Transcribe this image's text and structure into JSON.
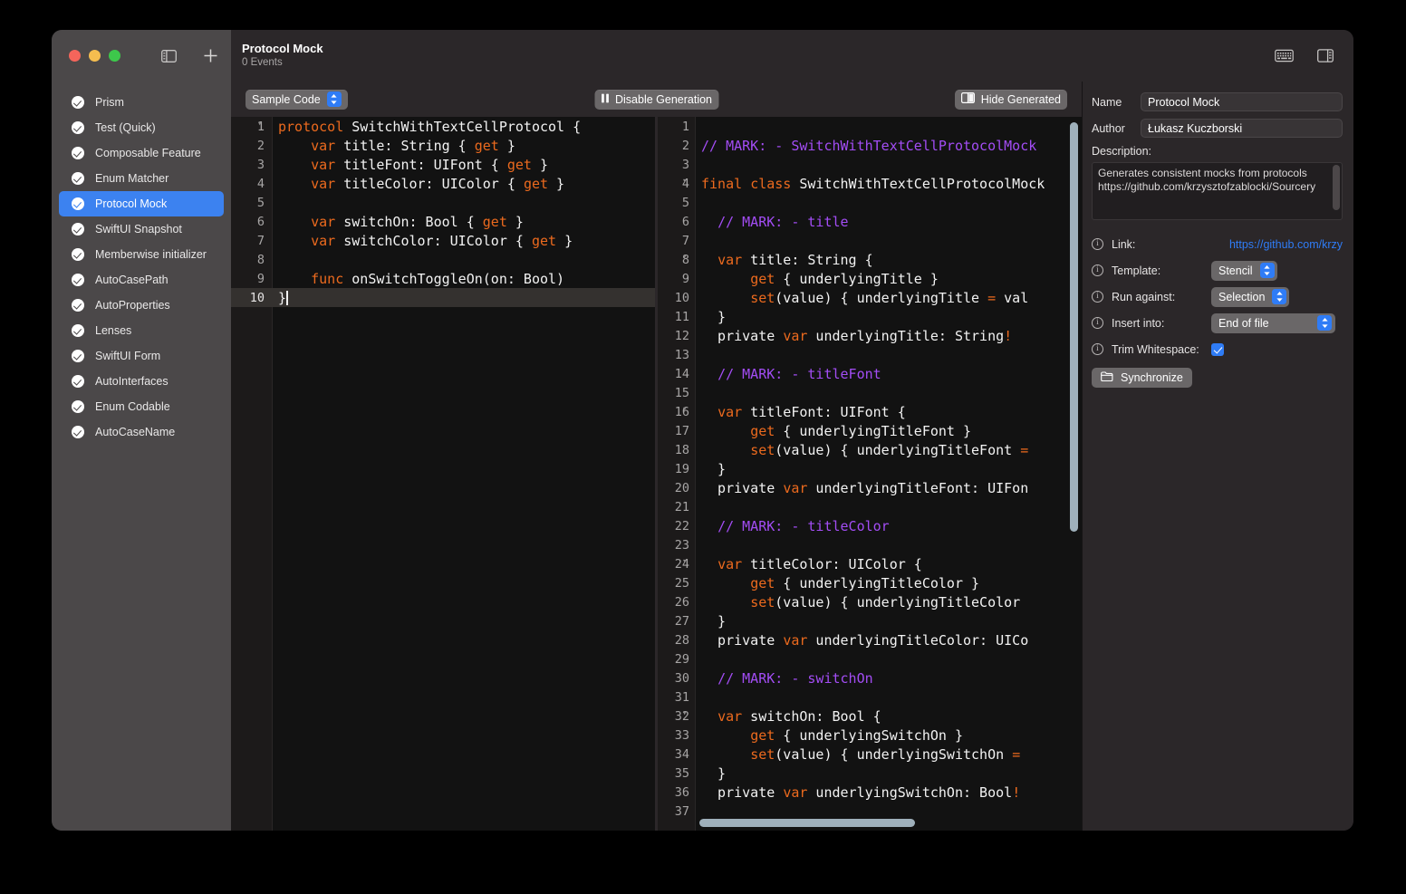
{
  "titlebar": {
    "document_title": "Protocol Mock",
    "document_subtitle": "0 Events",
    "sidebar_toggle_icon": "sidebar-toggle-icon",
    "add_icon": "plus-icon",
    "keyboard_icon": "keyboard-icon",
    "inspector_toggle_icon": "inspector-toggle-icon"
  },
  "sidebar": {
    "items": [
      {
        "label": "Prism",
        "selected": false
      },
      {
        "label": "Test (Quick)",
        "selected": false
      },
      {
        "label": "Composable Feature",
        "selected": false
      },
      {
        "label": "Enum Matcher",
        "selected": false
      },
      {
        "label": "Protocol Mock",
        "selected": true
      },
      {
        "label": "SwiftUI Snapshot",
        "selected": false
      },
      {
        "label": "Memberwise initializer",
        "selected": false
      },
      {
        "label": "AutoCasePath",
        "selected": false
      },
      {
        "label": "AutoProperties",
        "selected": false
      },
      {
        "label": "Lenses",
        "selected": false
      },
      {
        "label": "SwiftUI Form",
        "selected": false
      },
      {
        "label": "AutoInterfaces",
        "selected": false
      },
      {
        "label": "Enum Codable",
        "selected": false
      },
      {
        "label": "AutoCaseName",
        "selected": false
      }
    ]
  },
  "toolbar": {
    "sample_code_label": "Sample Code",
    "disable_generation_label": "Disable Generation",
    "hide_generated_label": "Hide Generated",
    "pause_icon": "pause-icon",
    "panel_icon": "panel-split-icon"
  },
  "source_editor": {
    "lines": [
      {
        "n": "1",
        "fold": true,
        "html": "<span class=\"kw\">protocol</span> SwitchWithTextCellProtocol {"
      },
      {
        "n": "2",
        "fold": false,
        "html": "    <span class=\"kw\">var</span> title: String { <span class=\"kw\">get</span> }"
      },
      {
        "n": "3",
        "fold": false,
        "html": "    <span class=\"kw\">var</span> titleFont: UIFont { <span class=\"kw\">get</span> }"
      },
      {
        "n": "4",
        "fold": false,
        "html": "    <span class=\"kw\">var</span> titleColor: UIColor { <span class=\"kw\">get</span> }"
      },
      {
        "n": "5",
        "fold": false,
        "html": ""
      },
      {
        "n": "6",
        "fold": false,
        "html": "    <span class=\"kw\">var</span> switchOn: Bool { <span class=\"kw\">get</span> }"
      },
      {
        "n": "7",
        "fold": false,
        "html": "    <span class=\"kw\">var</span> switchColor: UIColor { <span class=\"kw\">get</span> }"
      },
      {
        "n": "8",
        "fold": false,
        "html": ""
      },
      {
        "n": "9",
        "fold": false,
        "html": "    <span class=\"kw\">func</span> onSwitchToggleOn(on: Bool)"
      },
      {
        "n": "10",
        "fold": false,
        "current": true,
        "html": "}<span class=\"caret\"></span>"
      }
    ]
  },
  "generated_editor": {
    "lines": [
      {
        "n": "1",
        "html": ""
      },
      {
        "n": "2",
        "html": "<span class=\"mk\">// MARK: - SwitchWithTextCellProtocolMock</span>"
      },
      {
        "n": "3",
        "html": ""
      },
      {
        "n": "4",
        "fold": true,
        "html": "<span class=\"kw\">final</span> <span class=\"kw\">class</span> SwitchWithTextCellProtocolMock"
      },
      {
        "n": "5",
        "html": ""
      },
      {
        "n": "6",
        "html": "  <span class=\"mk\">// MARK: - title</span>"
      },
      {
        "n": "7",
        "html": ""
      },
      {
        "n": "8",
        "fold": true,
        "html": "  <span class=\"kw\">var</span> title: String {"
      },
      {
        "n": "9",
        "html": "      <span class=\"kw\">get</span> { underlyingTitle }"
      },
      {
        "n": "10",
        "html": "      <span class=\"kw\">set</span>(value) { underlyingTitle <span class=\"op\">=</span> val"
      },
      {
        "n": "11",
        "html": "  }"
      },
      {
        "n": "12",
        "html": "  private <span class=\"kw\">var</span> underlyingTitle: String<span class=\"bang\">!</span>"
      },
      {
        "n": "13",
        "html": ""
      },
      {
        "n": "14",
        "html": "  <span class=\"mk\">// MARK: - titleFont</span>"
      },
      {
        "n": "15",
        "html": ""
      },
      {
        "n": "16",
        "fold": true,
        "html": "  <span class=\"kw\">var</span> titleFont: UIFont {"
      },
      {
        "n": "17",
        "html": "      <span class=\"kw\">get</span> { underlyingTitleFont }"
      },
      {
        "n": "18",
        "html": "      <span class=\"kw\">set</span>(value) { underlyingTitleFont <span class=\"op\">=</span>"
      },
      {
        "n": "19",
        "html": "  }"
      },
      {
        "n": "20",
        "html": "  private <span class=\"kw\">var</span> underlyingTitleFont: UIFon"
      },
      {
        "n": "21",
        "html": ""
      },
      {
        "n": "22",
        "html": "  <span class=\"mk\">// MARK: - titleColor</span>"
      },
      {
        "n": "23",
        "html": ""
      },
      {
        "n": "24",
        "fold": true,
        "html": "  <span class=\"kw\">var</span> titleColor: UIColor {"
      },
      {
        "n": "25",
        "html": "      <span class=\"kw\">get</span> { underlyingTitleColor }"
      },
      {
        "n": "26",
        "html": "      <span class=\"kw\">set</span>(value) { underlyingTitleColor"
      },
      {
        "n": "27",
        "html": "  }"
      },
      {
        "n": "28",
        "html": "  private <span class=\"kw\">var</span> underlyingTitleColor: UICo"
      },
      {
        "n": "29",
        "html": ""
      },
      {
        "n": "30",
        "html": "  <span class=\"mk\">// MARK: - switchOn</span>"
      },
      {
        "n": "31",
        "html": ""
      },
      {
        "n": "32",
        "fold": true,
        "html": "  <span class=\"kw\">var</span> switchOn: Bool {"
      },
      {
        "n": "33",
        "html": "      <span class=\"kw\">get</span> { underlyingSwitchOn }"
      },
      {
        "n": "34",
        "html": "      <span class=\"kw\">set</span>(value) { underlyingSwitchOn <span class=\"op\">=</span>"
      },
      {
        "n": "35",
        "html": "  }"
      },
      {
        "n": "36",
        "html": "  private <span class=\"kw\">var</span> underlyingSwitchOn: Bool<span class=\"bang\">!</span>"
      },
      {
        "n": "37",
        "html": ""
      }
    ]
  },
  "inspector": {
    "name_label": "Name",
    "name_value": "Protocol Mock",
    "author_label": "Author",
    "author_value": "Łukasz Kuczborski",
    "description_label": "Description:",
    "description_value": "Generates consistent mocks from protocols\nhttps://github.com/krzysztofzablocki/Sourcery",
    "link_label": "Link:",
    "link_value": "https://github.com/krzy",
    "template_label": "Template:",
    "template_value": "Stencil",
    "run_against_label": "Run against:",
    "run_against_value": "Selection",
    "insert_into_label": "Insert into:",
    "insert_into_value": "End of file",
    "trim_whitespace_label": "Trim Whitespace:",
    "trim_whitespace_checked": true,
    "synchronize_label": "Synchronize",
    "folder_icon": "folder-icon",
    "info_icon": "info-circle-icon"
  },
  "colors": {
    "accent": "#3c82f0",
    "link": "#2f7cf6",
    "keyword": "#ec6a1e",
    "comment": "#a34df5",
    "editor_bg": "#121212",
    "chrome_bg": "#2b2729",
    "sidebar_bg": "#4b4849"
  }
}
